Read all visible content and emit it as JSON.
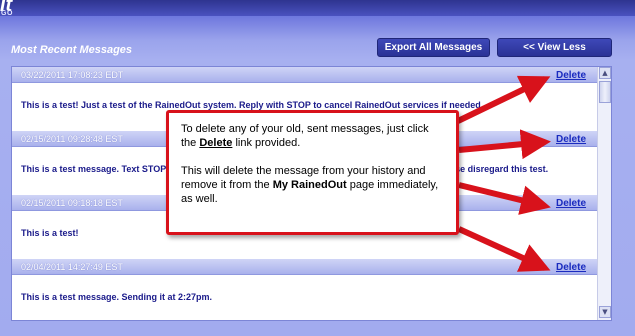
{
  "app": {
    "logo_text": "it",
    "logo_sub": "GO"
  },
  "header": {
    "section_title": "Most Recent Messages",
    "export_button": "Export All Messages",
    "view_less_button": "<< View Less"
  },
  "messages": [
    {
      "date": "03/22/2011 17:08:23 EDT",
      "delete": "Delete",
      "body": "This is a test! Just a test of the RainedOut system. Reply with STOP to cancel RainedOut services if needed."
    },
    {
      "date": "02/15/2011 09:28:48 EST",
      "delete": "Delete",
      "body": "This is a test message. Text STOP to cancel any further notifications from RainedOut. Otherwise, please disregard this test."
    },
    {
      "date": "02/15/2011 09:18:18 EST",
      "delete": "Delete",
      "body": "This is a test!"
    },
    {
      "date": "02/04/2011 14:27:49 EST",
      "delete": "Delete",
      "body": "This is a test message. Sending it at 2:27pm."
    }
  ],
  "callout": {
    "line1_pre": "To delete any of your old, sent messages, just click the ",
    "line1_link": "Delete",
    "line1_post": " link provided.",
    "line2_pre": "This will delete the message from your history and remove it from the ",
    "line2_bold": "My RainedOut",
    "line2_post": " page immediately, as well."
  },
  "colors": {
    "arrow": "#d8121b",
    "link": "#1a2bbf",
    "button": "#2f379f"
  }
}
